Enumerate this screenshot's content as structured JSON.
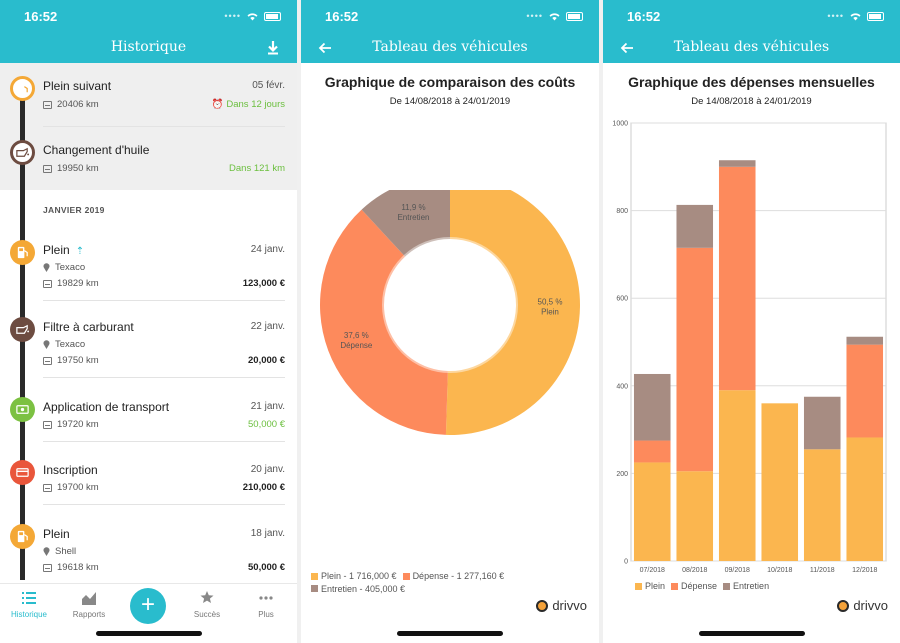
{
  "status": {
    "time": "16:52"
  },
  "history": {
    "title": "Historique",
    "upcoming": [
      {
        "title": "Plein suivant",
        "date": "05 févr.",
        "km": "20406 km",
        "due": "Dans 12 jours",
        "icon": "fuel-pump-icon",
        "color": "#f4a836"
      },
      {
        "title": "Changement d'huile",
        "date": "",
        "km": "19950 km",
        "due": "Dans 121 km",
        "icon": "oil-can-icon",
        "color": "#6d4c41"
      }
    ],
    "month": "JANVIER 2019",
    "entries": [
      {
        "title": "Plein",
        "date": "24 janv.",
        "place": "Texaco",
        "km": "19829 km",
        "amount": "123,000 €",
        "icon": "fuel-pump-icon",
        "color": "#f4a836",
        "green": false
      },
      {
        "title": "Filtre à carburant",
        "date": "22 janv.",
        "place": "Texaco",
        "km": "19750 km",
        "amount": "20,000 €",
        "icon": "oil-can-icon",
        "color": "#6d4c41",
        "green": false
      },
      {
        "title": "Application de transport",
        "date": "21 janv.",
        "place": "",
        "km": "19720 km",
        "amount": "50,000 €",
        "icon": "money-icon",
        "color": "#7cc142",
        "green": true
      },
      {
        "title": "Inscription",
        "date": "20 janv.",
        "place": "",
        "km": "19700 km",
        "amount": "210,000 €",
        "icon": "card-icon",
        "color": "#e9563b",
        "green": false
      },
      {
        "title": "Plein",
        "date": "18 janv.",
        "place": "Shell",
        "km": "19618 km",
        "amount": "50,000 €",
        "icon": "fuel-pump-icon",
        "color": "#f4a836",
        "green": false
      }
    ],
    "tabs": {
      "history": "Historique",
      "reports": "Rapports",
      "success": "Succès",
      "more": "Plus"
    },
    "fab": "+"
  },
  "cost_compare": {
    "title": "Tableau des véhicules",
    "chart_title": "Graphique de comparaison des coûts",
    "range": "De 14/08/2018 à 24/01/2019",
    "legend": [
      "Plein - 1 716,000 €",
      "Dépense - 1 277,160 €",
      "Entretien - 405,000 €"
    ],
    "brand": "drivvo"
  },
  "monthly": {
    "title": "Tableau des véhicules",
    "chart_title": "Graphique des dépenses mensuelles",
    "range": "De 14/08/2018 à 24/01/2019",
    "legend": [
      "Plein",
      "Dépense",
      "Entretien"
    ],
    "brand": "drivvo"
  },
  "colors": {
    "accent": "#29bccd",
    "plein": "#fbb64f",
    "depense": "#fd8a5c",
    "entretien": "#a78c82"
  },
  "chart_data": [
    {
      "type": "pie",
      "title": "Graphique de comparaison des coûts",
      "subtitle": "De 14/08/2018 à 24/01/2019",
      "categories": [
        "Plein",
        "Dépense",
        "Entretien"
      ],
      "values": [
        50.5,
        37.6,
        11.9
      ],
      "labels": [
        "50,5  %",
        "37,6  %",
        "11,9  %"
      ],
      "colors": [
        "#fbb64f",
        "#fd8a5c",
        "#a78c82"
      ],
      "donut": true,
      "legend_position": "bottom-left"
    },
    {
      "type": "bar",
      "stacked": true,
      "title": "Graphique des dépenses mensuelles",
      "subtitle": "De 14/08/2018 à 24/01/2019",
      "categories": [
        "07/2018",
        "08/2018",
        "09/2018",
        "10/2018",
        "11/2018",
        "12/2018"
      ],
      "series": [
        {
          "name": "Plein",
          "values": [
            225,
            205,
            390,
            360,
            255,
            282
          ],
          "color": "#fbb64f"
        },
        {
          "name": "Dépense",
          "values": [
            50,
            510,
            510,
            0,
            0,
            212
          ],
          "color": "#fd8a5c"
        },
        {
          "name": "Entretien",
          "values": [
            152,
            98,
            15,
            0,
            120,
            18
          ],
          "color": "#a78c82"
        }
      ],
      "ylim": [
        0,
        1000
      ],
      "yticks": [
        0,
        200,
        400,
        600,
        800,
        1000
      ],
      "grid": true,
      "legend_position": "bottom"
    }
  ]
}
